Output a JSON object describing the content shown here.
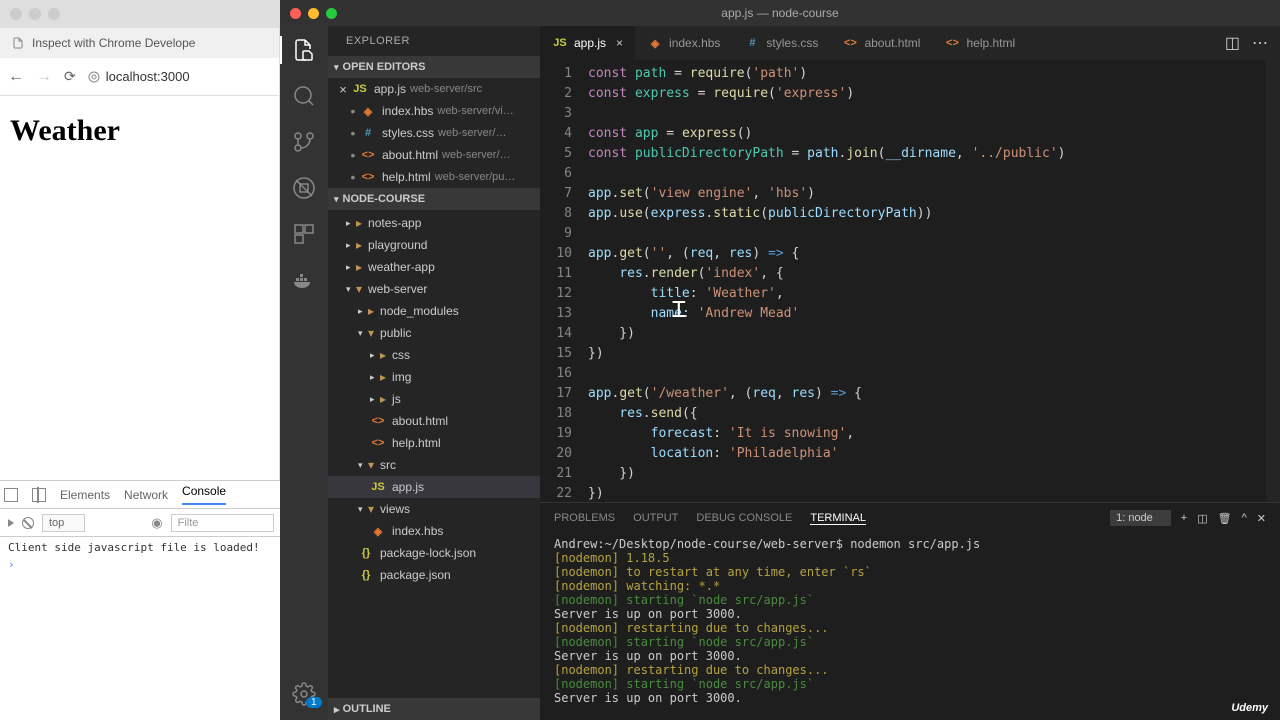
{
  "chrome": {
    "tab_title": "Inspect with Chrome Develope",
    "url": "localhost:3000",
    "page_heading": "Weather",
    "devtools": {
      "tabs": [
        "Elements",
        "Network",
        "Console"
      ],
      "active_tab": "Console",
      "context_select": "top",
      "filter_placeholder": "Filte",
      "console_line": "Client side javascript file is loaded!"
    }
  },
  "vscode": {
    "window_title": "app.js — node-course",
    "explorer_title": "EXPLORER",
    "open_editors_label": "OPEN EDITORS",
    "project_label": "NODE-COURSE",
    "outline_label": "OUTLINE",
    "open_editors": [
      {
        "icon": "js",
        "name": "app.js",
        "path": "web-server/src",
        "modified": true
      },
      {
        "icon": "hbs",
        "name": "index.hbs",
        "path": "web-server/vi…"
      },
      {
        "icon": "css",
        "name": "styles.css",
        "path": "web-server/…"
      },
      {
        "icon": "html",
        "name": "about.html",
        "path": "web-server/…"
      },
      {
        "icon": "html",
        "name": "help.html",
        "path": "web-server/pu…"
      }
    ],
    "tree": {
      "folders_top": [
        "notes-app",
        "playground",
        "weather-app"
      ],
      "webserver": "web-server",
      "node_modules": "node_modules",
      "public": "public",
      "public_folders": [
        "css",
        "img",
        "js"
      ],
      "public_files": [
        {
          "icon": "html",
          "name": "about.html"
        },
        {
          "icon": "html",
          "name": "help.html"
        }
      ],
      "src": "src",
      "src_file": {
        "icon": "js",
        "name": "app.js"
      },
      "views": "views",
      "views_file": {
        "icon": "hbs",
        "name": "index.hbs"
      },
      "root_files": [
        {
          "icon": "json",
          "name": "package-lock.json"
        },
        {
          "icon": "json",
          "name": "package.json"
        }
      ]
    },
    "tabs": [
      {
        "icon": "js",
        "name": "app.js",
        "active": true,
        "close": true
      },
      {
        "icon": "hbs",
        "name": "index.hbs"
      },
      {
        "icon": "css",
        "name": "styles.css"
      },
      {
        "icon": "html",
        "name": "about.html"
      },
      {
        "icon": "html",
        "name": "help.html"
      }
    ],
    "code": {
      "l1": {
        "a": "const ",
        "b": "path",
        "c": " = ",
        "d": "require",
        "e": "(",
        "f": "'path'",
        "g": ")"
      },
      "l2": {
        "a": "const ",
        "b": "express",
        "c": " = ",
        "d": "require",
        "e": "(",
        "f": "'express'",
        "g": ")"
      },
      "l4": {
        "a": "const ",
        "b": "app",
        "c": " = ",
        "d": "express",
        "e": "()"
      },
      "l5": {
        "a": "const ",
        "b": "publicDirectoryPath",
        "c": " = ",
        "d": "path",
        "e": ".",
        "f": "join",
        "g": "(",
        "h": "__dirname",
        "i": ", ",
        "j": "'../public'",
        "k": ")"
      },
      "l7": {
        "a": "app",
        "b": ".",
        "c": "set",
        "d": "(",
        "e": "'view engine'",
        "f": ", ",
        "g": "'hbs'",
        "h": ")"
      },
      "l8": {
        "a": "app",
        "b": ".",
        "c": "use",
        "d": "(",
        "e": "express",
        "f": ".",
        "g": "static",
        "h": "(",
        "i": "publicDirectoryPath",
        "j": "))"
      },
      "l10": {
        "a": "app",
        "b": ".",
        "c": "get",
        "d": "(",
        "e": "''",
        "f": ", (",
        "g": "req",
        "h": ", ",
        "i": "res",
        "j": ") ",
        "k": "=>",
        "l": " {"
      },
      "l11": {
        "a": "    ",
        "b": "res",
        "c": ".",
        "d": "render",
        "e": "(",
        "f": "'index'",
        "g": ", {"
      },
      "l12": {
        "a": "        ",
        "b": "title",
        "c": ": ",
        "d": "'Weather'",
        "e": ","
      },
      "l13": {
        "a": "        ",
        "b": "name",
        "c": ": ",
        "d": "'Andrew Mead'"
      },
      "l14": {
        "a": "    })"
      },
      "l15": {
        "a": "})"
      },
      "l17": {
        "a": "app",
        "b": ".",
        "c": "get",
        "d": "(",
        "e": "'/weather'",
        "f": ", (",
        "g": "req",
        "h": ", ",
        "i": "res",
        "j": ") ",
        "k": "=>",
        "l": " {"
      },
      "l18": {
        "a": "    ",
        "b": "res",
        "c": ".",
        "d": "send",
        "e": "({"
      },
      "l19": {
        "a": "        ",
        "b": "forecast",
        "c": ": ",
        "d": "'It is snowing'",
        "e": ","
      },
      "l20": {
        "a": "        ",
        "b": "location",
        "c": ": ",
        "d": "'Philadelphia'"
      },
      "l21": {
        "a": "    })"
      },
      "l22": {
        "a": "})"
      }
    },
    "panel": {
      "tabs": [
        "PROBLEMS",
        "OUTPUT",
        "DEBUG CONSOLE",
        "TERMINAL"
      ],
      "active": "TERMINAL",
      "select": "1: node",
      "lines": [
        {
          "cls": "tw",
          "t": "Andrew:~/Desktop/node-course/web-server$ nodemon src/app.js"
        },
        {
          "cls": "ty",
          "t": "[nodemon] 1.18.5"
        },
        {
          "cls": "ty",
          "t": "[nodemon] to restart at any time, enter `rs`"
        },
        {
          "cls": "ty",
          "t": "[nodemon] watching: *.*"
        },
        {
          "cls": "tg",
          "t": "[nodemon] starting `node src/app.js`"
        },
        {
          "cls": "tw",
          "t": "Server is up on port 3000."
        },
        {
          "cls": "ty",
          "t": "[nodemon] restarting due to changes..."
        },
        {
          "cls": "tg",
          "t": "[nodemon] starting `node src/app.js`"
        },
        {
          "cls": "tw",
          "t": "Server is up on port 3000."
        },
        {
          "cls": "ty",
          "t": "[nodemon] restarting due to changes..."
        },
        {
          "cls": "tg",
          "t": "[nodemon] starting `node src/app.js`"
        },
        {
          "cls": "tw",
          "t": "Server is up on port 3000."
        }
      ]
    },
    "udemy": "Udemy"
  }
}
